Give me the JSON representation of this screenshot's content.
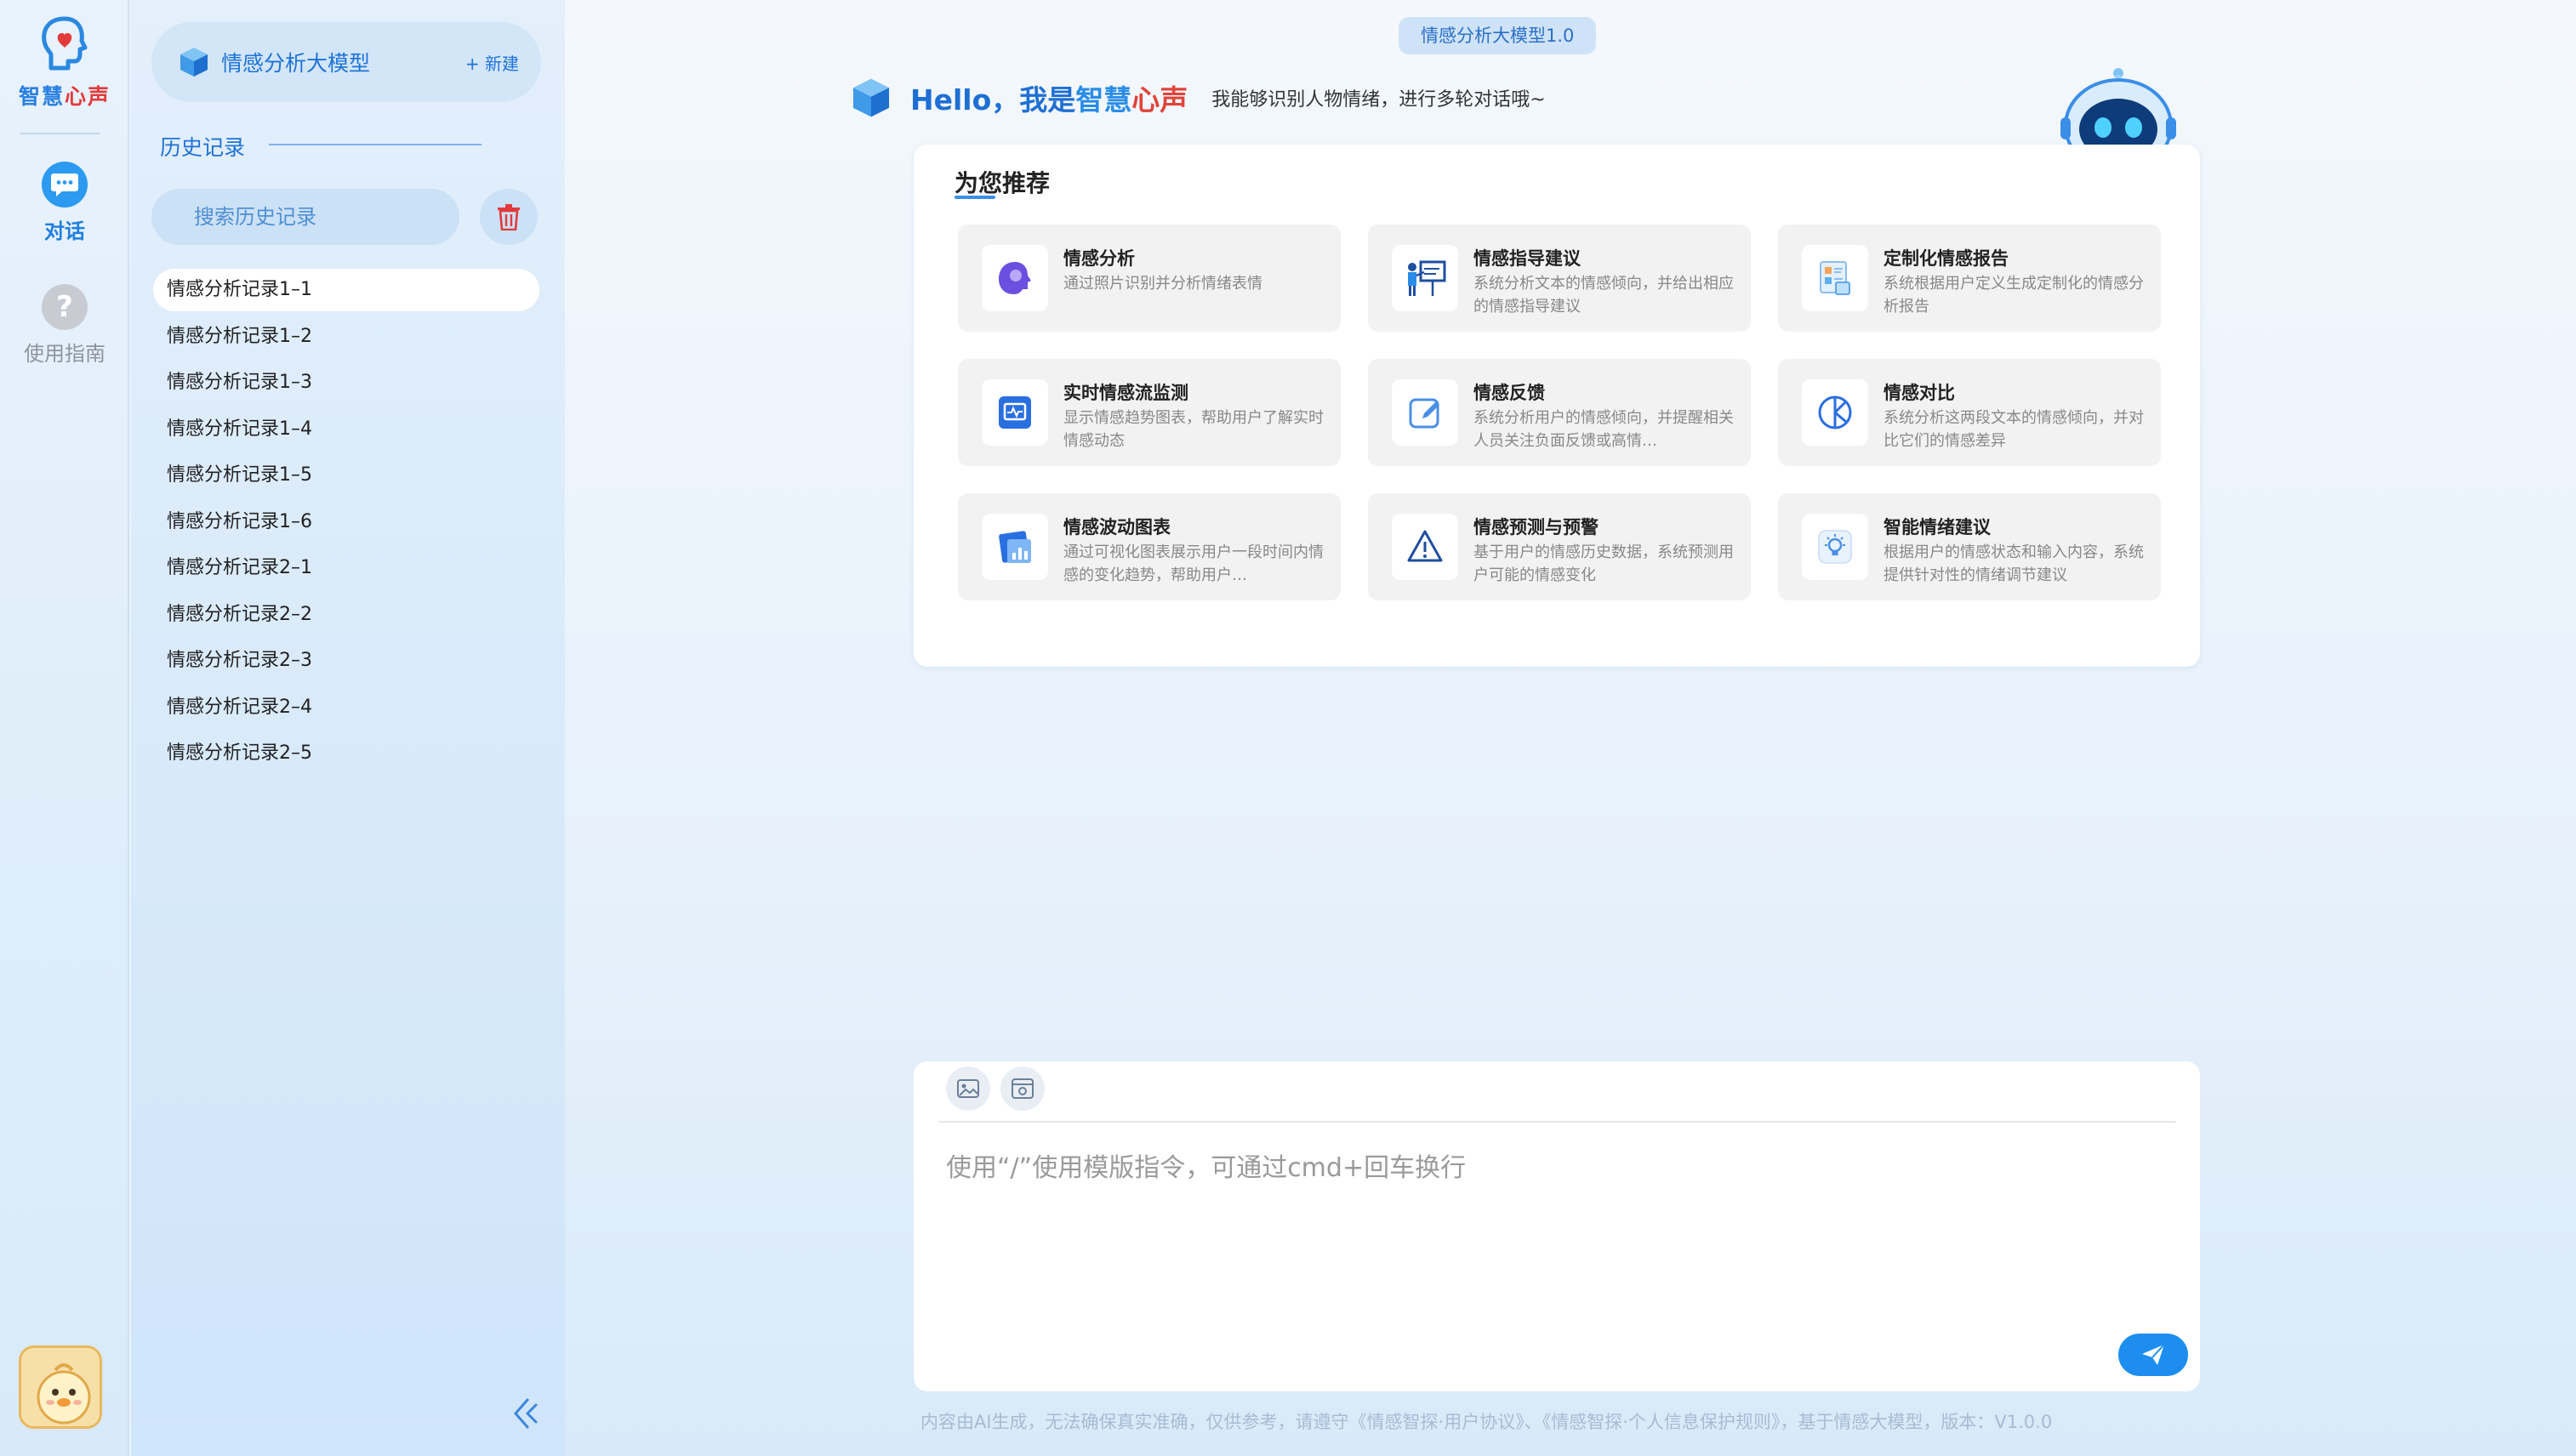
{
  "brand": {
    "part1": "智慧",
    "part2": "心声"
  },
  "nav": {
    "chat_label": "对话",
    "guide_label": "使用指南"
  },
  "sidebar": {
    "model_name": "情感分析大模型",
    "new_label": "+ 新建",
    "history_title": "历史记录",
    "search_placeholder": "搜索历史记录",
    "items": [
      "情感分析记录1–1",
      "情感分析记录1–2",
      "情感分析记录1–3",
      "情感分析记录1–4",
      "情感分析记录1–5",
      "情感分析记录1–6",
      "情感分析记录2–1",
      "情感分析记录2–2",
      "情感分析记录2–3",
      "情感分析记录2–4",
      "情感分析记录2–5"
    ]
  },
  "main": {
    "version": "情感分析大模型1.0",
    "greeting_prefix": "Hello，我是",
    "greeting_c1": "智慧",
    "greeting_c2": "心声",
    "greeting_sub": "我能够识别人物情绪，进行多轮对话哦~",
    "recommend_title": "为您推荐",
    "recommendations": [
      {
        "name": "情感分析",
        "desc": "通过照片识别并分析情绪表情",
        "icon": "face-scan-icon"
      },
      {
        "name": "情感指导建议",
        "desc": "系统分析文本的情感倾向，并给出相应的情感指导建议",
        "icon": "presentation-icon"
      },
      {
        "name": "定制化情感报告",
        "desc": "系统根据用户定义生成定制化的情感分析报告",
        "icon": "report-icon"
      },
      {
        "name": "实时情感流监测",
        "desc": "显示情感趋势图表，帮助用户了解实时情感动态",
        "icon": "monitor-icon"
      },
      {
        "name": "情感反馈",
        "desc": "系统分析用户的情感倾向，并提醒相关人员关注负面反馈或高情…",
        "icon": "edit-icon"
      },
      {
        "name": "情感对比",
        "desc": "系统分析这两段文本的情感倾向，并对比它们的情感差异",
        "icon": "compare-icon"
      },
      {
        "name": "情感波动图表",
        "desc": "通过可视化图表展示用户一段时间内情感的变化趋势，帮助用户…",
        "icon": "bar-chart-icon"
      },
      {
        "name": "情感预测与预警",
        "desc": "基于用户的情感历史数据，系统预测用户可能的情感变化",
        "icon": "warning-icon"
      },
      {
        "name": "智能情绪建议",
        "desc": "根据用户的情感状态和输入内容，系统提供针对性的情绪调节建议",
        "icon": "lightbulb-icon"
      }
    ],
    "input_placeholder": "使用“/”使用模版指令，可通过cmd+回车换行",
    "footer": "内容由AI生成，无法确保真实准确，仅供参考，请遵守《情感智探·用户协议》、《情感智探·个人信息保护规则》，基于情感大模型，版本：V1.0.0"
  },
  "colors": {
    "accent": "#1d8ef0",
    "brand_red": "#e23b3b",
    "active_item_bg": "#ffffff"
  }
}
